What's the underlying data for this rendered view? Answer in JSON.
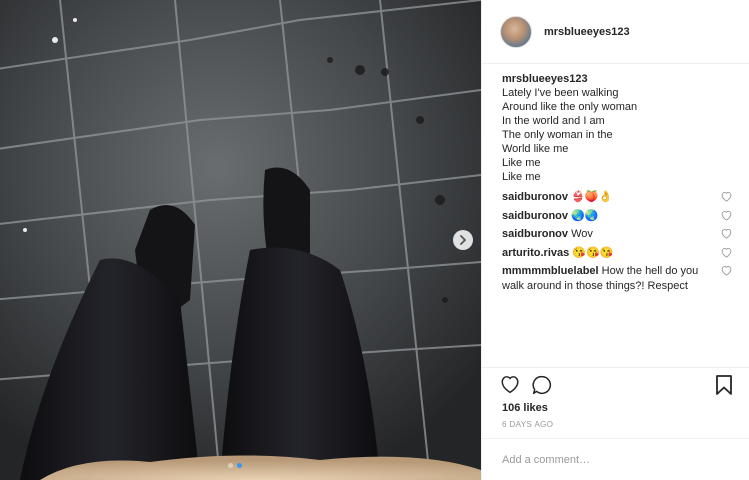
{
  "post": {
    "username": "mrsblueeyes123",
    "caption_lines": [
      "Lately I've been walking",
      "Around like the only woman",
      "In the world and I am",
      "The only woman in the",
      "World like me",
      "Like me",
      "Like me"
    ]
  },
  "comments": [
    {
      "user": "saidburonov",
      "text": "👙🍑👌"
    },
    {
      "user": "saidburonov",
      "text": "🌏🌏"
    },
    {
      "user": "saidburonov",
      "text": "Wov"
    },
    {
      "user": "arturito.rivas",
      "text": "😘😘😘"
    },
    {
      "user": "mmmmmbluelabel",
      "text": "How the hell do you walk around in those things?! Respect"
    }
  ],
  "stats": {
    "likes": "106 likes",
    "date": "6 DAYS AGO"
  },
  "add_comment": {
    "placeholder": "Add a comment…"
  },
  "carousel": {
    "active_index": 1,
    "count": 2
  },
  "icons": {
    "like": "heart-icon",
    "comment": "comment-icon",
    "save": "bookmark-icon",
    "next": "chevron-right-icon"
  },
  "colors": {
    "accent": "#3897f0",
    "text": "#262626",
    "muted": "#999999"
  }
}
